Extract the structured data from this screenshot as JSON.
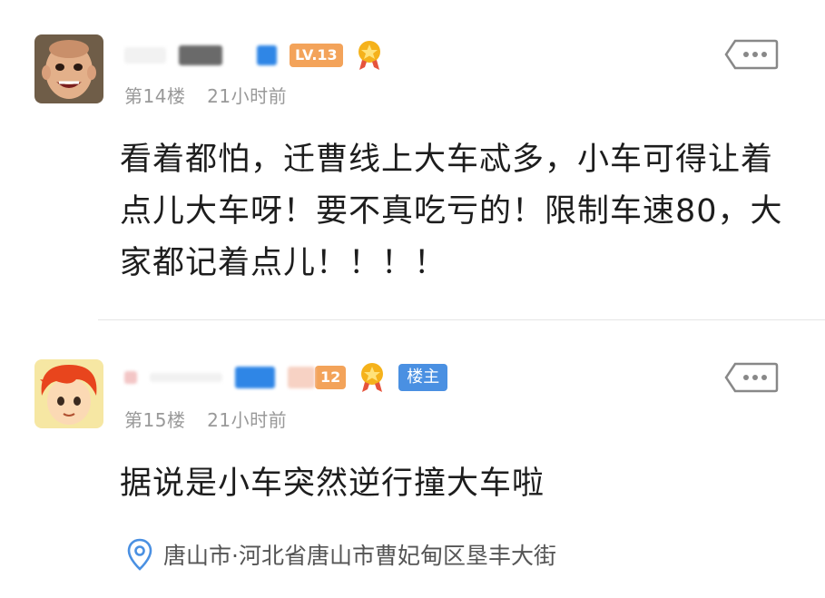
{
  "posts": [
    {
      "floor": "第14楼",
      "time": "21小时前",
      "level": "LV.13",
      "content": "看着都怕，迁曹线上大车忒多，小车可得让着点儿大车呀！要不真吃亏的！限制车速80，大家都记着点儿！！！！",
      "more_icon": "more-icon"
    },
    {
      "floor": "第15楼",
      "time": "21小时前",
      "level": "12",
      "owner_badge": "楼主",
      "content": "据说是小车突然逆行撞大车啦",
      "location": "唐山市·河北省唐山市曹妃甸区垦丰大街",
      "more_icon": "more-icon"
    }
  ],
  "colors": {
    "level_badge": "#f3a35a",
    "owner_badge": "#4a90e2",
    "meta_text": "#999999",
    "content_text": "#1d1d1d"
  }
}
